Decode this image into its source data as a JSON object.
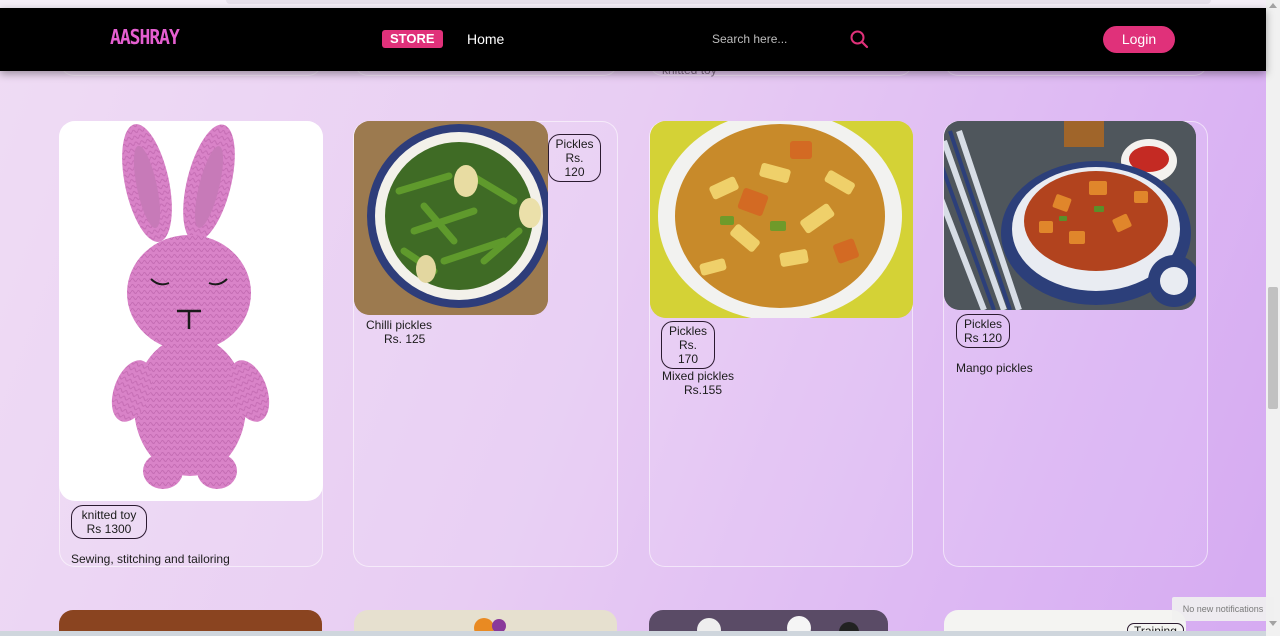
{
  "navbar": {
    "logo": "AASHRAY",
    "store_label": "STORE",
    "home_label": "Home",
    "search_placeholder": "Search here...",
    "login_label": "Login"
  },
  "prev_row": {
    "caption": "knitted toy"
  },
  "products": [
    {
      "badge_line1": "knitted toy",
      "badge_line2": "Rs 1300",
      "title": "Sewing, stitching and tailoring",
      "price": ""
    },
    {
      "badge_line1": "Pickles",
      "badge_line2": "Rs. 120",
      "title": "Chilli pickles",
      "price": "Rs. 125"
    },
    {
      "badge_line1": "Pickles",
      "badge_line2": "Rs. 170",
      "title": "Mixed pickles",
      "price": "Rs.155"
    },
    {
      "badge_line1": "Pickles",
      "badge_line2": "Rs 120",
      "title": "Mango pickles",
      "price": ""
    }
  ],
  "next_row": {
    "badge": "Training"
  },
  "notification": "No new notifications",
  "colors": {
    "accent": "#e0317a",
    "logo": "#e55fd0",
    "navbar_bg": "#000000"
  }
}
